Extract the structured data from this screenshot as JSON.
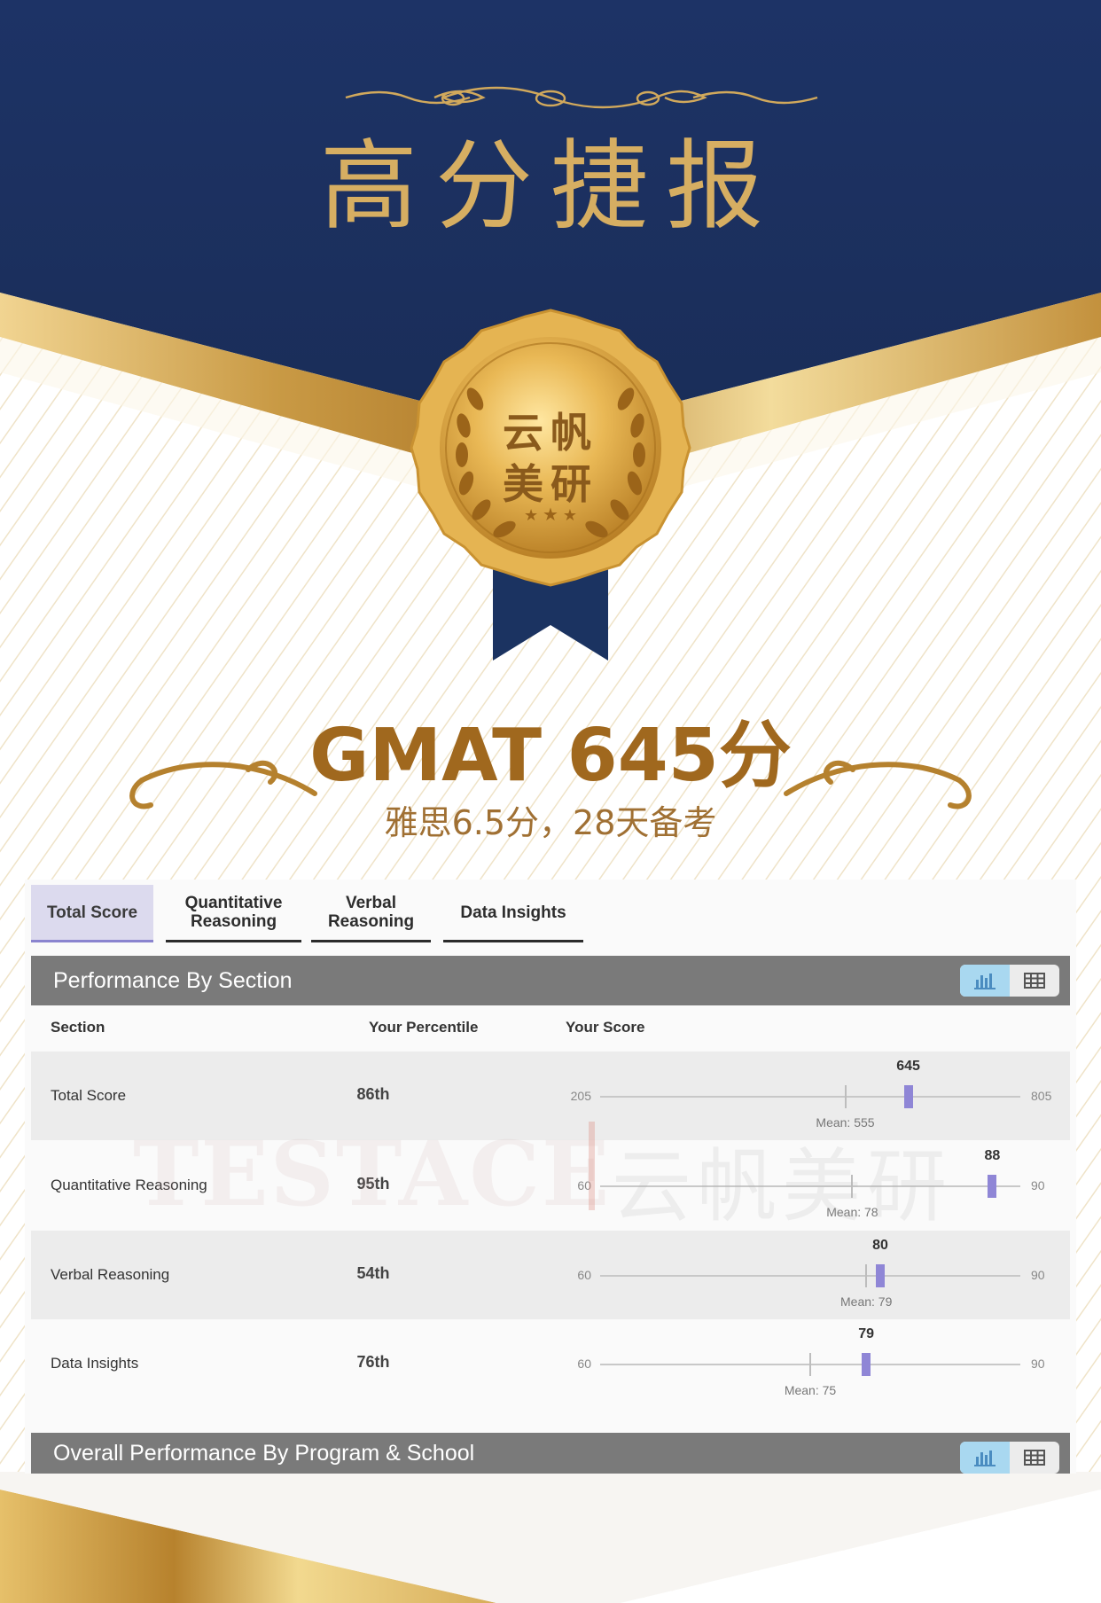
{
  "poster": {
    "headline": "高分捷报",
    "seal_line_1": "云帆",
    "seal_line_2": "美研",
    "score_title": "GMAT 645分",
    "score_subtitle": "雅思6.5分，28天备考",
    "watermark_latin": "TESTACE",
    "watermark_cn": "云帆美研"
  },
  "colors": {
    "navy": "#1f3464",
    "gold": "#d6ae62",
    "accent_purple": "#8f86d6"
  },
  "tabs": [
    {
      "label_1": "Total Score",
      "label_2": ""
    },
    {
      "label_1": "Quantitative",
      "label_2": "Reasoning"
    },
    {
      "label_1": "Verbal",
      "label_2": "Reasoning"
    },
    {
      "label_1": "Data Insights",
      "label_2": ""
    }
  ],
  "active_tab": "Total Score",
  "performance": {
    "title": "Performance By Section",
    "columns": [
      "Section",
      "Your Percentile",
      "Your Score"
    ],
    "rows": [
      {
        "section": "Total Score",
        "percentile": "86th",
        "score": "645",
        "min": "205",
        "max": "805",
        "mean_label": "Mean: 555"
      },
      {
        "section": "Quantitative Reasoning",
        "percentile": "95th",
        "score": "88",
        "min": "60",
        "max": "90",
        "mean_label": "Mean: 78"
      },
      {
        "section": "Verbal Reasoning",
        "percentile": "54th",
        "score": "80",
        "min": "60",
        "max": "90",
        "mean_label": "Mean: 79"
      },
      {
        "section": "Data Insights",
        "percentile": "76th",
        "score": "79",
        "min": "60",
        "max": "90",
        "mean_label": "Mean: 75"
      }
    ],
    "view_icons": [
      "bar-chart-icon",
      "table-icon"
    ]
  },
  "overall": {
    "title": "Overall Performance By Program & School"
  },
  "chart_data": {
    "type": "bar",
    "title": "",
    "categories": [
      "Total Score",
      "Quantitative Reasoning",
      "Verbal Reasoning",
      "Data Insights"
    ],
    "series": [
      {
        "name": "Your Score",
        "values": [
          645,
          88,
          80,
          79
        ]
      },
      {
        "name": "Mean",
        "values": [
          555,
          78,
          79,
          75
        ]
      }
    ],
    "ranges": [
      [
        205,
        805
      ],
      [
        60,
        90
      ],
      [
        60,
        90
      ],
      [
        60,
        90
      ]
    ],
    "percentiles": [
      "86th",
      "95th",
      "54th",
      "76th"
    ]
  }
}
